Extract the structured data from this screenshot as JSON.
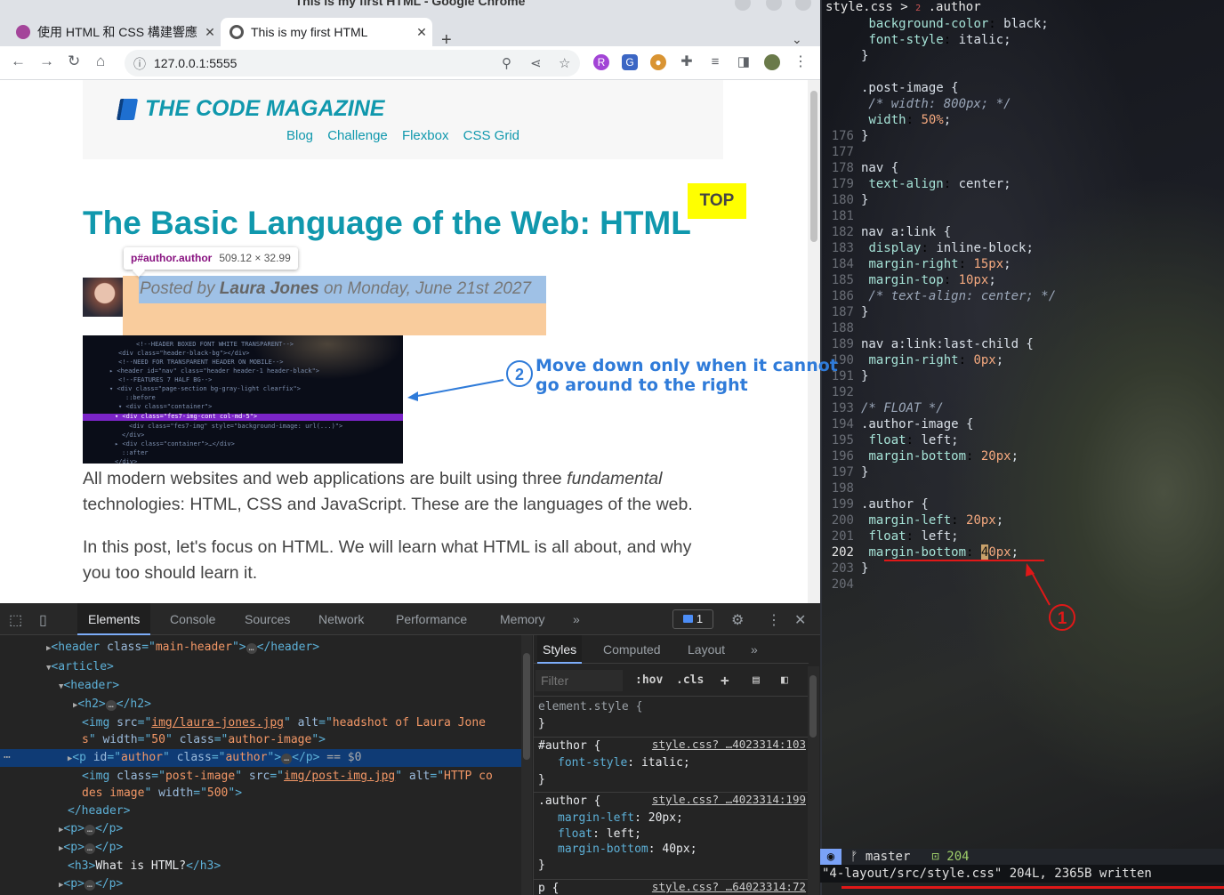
{
  "window": {
    "title": "This is my first HTML - Google Chrome"
  },
  "tabs": [
    {
      "label": "使用 HTML 和 CSS 構建響應",
      "close": "✕"
    },
    {
      "label": "This is my first HTML",
      "close": "✕"
    }
  ],
  "toolbar": {
    "url": "127.0.0.1:5555"
  },
  "page": {
    "logo": "THE CODE MAGAZINE",
    "nav": [
      "Blog",
      "Challenge",
      "Flexbox",
      "CSS Grid"
    ],
    "top_button": "TOP",
    "title": "The Basic Language of the Web: HTML",
    "tooltip": {
      "selector": "p#author.author",
      "size": "509.12 × 32.99"
    },
    "author": {
      "prefix": "Posted by ",
      "name": "Laura Jones",
      "suffix": " on Monday, June 21st 2027"
    },
    "para1_a": "All modern websites and web applications are built using three ",
    "para1_em": "fundamental",
    "para1_b": " technologies: HTML, CSS and JavaScript. These are the languages of the web.",
    "para2": "In this post, let's focus on HTML. We will learn what HTML is all about, and why you too should learn it."
  },
  "annotations": {
    "two": {
      "number": "2",
      "line1": "Move down only when it cannot",
      "line2": "go around to the right",
      "color": "#2f7bd9"
    },
    "one": {
      "number": "1",
      "color": "#e01818"
    }
  },
  "devtools": {
    "tabs": [
      "Elements",
      "Console",
      "Sources",
      "Network",
      "Performance",
      "Memory"
    ],
    "more": "»",
    "messages": "1",
    "dom": {
      "header_main": {
        "tag": "header",
        "attr": "class",
        "val": "main-header"
      },
      "article": "article",
      "header": "header",
      "h2": "h2",
      "img_src": "img/laura-jones.jpg",
      "img_alt_1": "headshot of Laura Jone",
      "img_alt_2": "s",
      "img_width": "50",
      "img_class": "author-image",
      "p_id": "author",
      "p_class": "author",
      "dollar0": "== $0",
      "img2_class": "post-image",
      "img2_src": "img/post-img.jpg",
      "img2_alt_1": "HTTP co",
      "img2_alt_2": "des image",
      "img2_width": "500",
      "h3_text": "What is HTML?"
    },
    "styles": {
      "tabs": [
        "Styles",
        "Computed",
        "Layout"
      ],
      "filter_placeholder": "Filter",
      "hov": ":hov",
      "cls": ".cls",
      "element_style": "element.style {",
      "rules": [
        {
          "selector": "#author {",
          "source": "style.css? …4023314:103",
          "decls": [
            {
              "prop": "font-style",
              "val": "italic;"
            }
          ]
        },
        {
          "selector": ".author {",
          "source": "style.css? …4023314:199",
          "decls": [
            {
              "prop": "margin-left",
              "val": "20px;"
            },
            {
              "prop": "float",
              "val": "left;"
            },
            {
              "prop": "margin-bottom",
              "val": "40px;"
            }
          ]
        },
        {
          "selector": "p {",
          "source": "style.css? …64023314:72",
          "decls": []
        }
      ]
    }
  },
  "editor": {
    "file": "style.css",
    "crumb": " > ",
    "crumb_num": "2",
    "crumb_sel": " .author",
    "lines": [
      {
        "n": "",
        "t": "  background-color: black;"
      },
      {
        "n": "",
        "t": "  font-style: italic;"
      },
      {
        "n": "",
        "t": "}"
      },
      {
        "n": "",
        "t": ""
      },
      {
        "n": "",
        "t": ".post-image {"
      },
      {
        "n": "",
        "t": "  /* width: 800px;  */"
      },
      {
        "n": "",
        "t": "  width: 50%;"
      },
      {
        "n": "176",
        "t": "}"
      },
      {
        "n": "177",
        "t": ""
      },
      {
        "n": "178",
        "t": "nav {"
      },
      {
        "n": "179",
        "t": "  text-align: center;"
      },
      {
        "n": "180",
        "t": "}"
      },
      {
        "n": "181",
        "t": ""
      },
      {
        "n": "182",
        "t": "nav a:link {"
      },
      {
        "n": "183",
        "t": "  display: inline-block;"
      },
      {
        "n": "184",
        "t": "  margin-right: 15px;"
      },
      {
        "n": "185",
        "t": "  margin-top: 10px;"
      },
      {
        "n": "186",
        "t": "  /* text-align: center; */"
      },
      {
        "n": "187",
        "t": "}"
      },
      {
        "n": "188",
        "t": ""
      },
      {
        "n": "189",
        "t": "nav a:link:last-child {"
      },
      {
        "n": "190",
        "t": "  margin-right: 0px;"
      },
      {
        "n": "191",
        "t": "}"
      },
      {
        "n": "192",
        "t": ""
      },
      {
        "n": "193",
        "t": "/* FLOAT */"
      },
      {
        "n": "194",
        "t": ".author-image {"
      },
      {
        "n": "195",
        "t": "  float: left;"
      },
      {
        "n": "196",
        "t": "  margin-bottom: 20px;"
      },
      {
        "n": "197",
        "t": "}"
      },
      {
        "n": "198",
        "t": ""
      },
      {
        "n": "199",
        "t": ".author {"
      },
      {
        "n": "200",
        "t": "  margin-left: 20px;"
      },
      {
        "n": "201",
        "t": "  float: left;"
      },
      {
        "n": "202",
        "t": "  margin-bottom: 40px;"
      },
      {
        "n": "203",
        "t": "}"
      },
      {
        "n": "204",
        "t": ""
      }
    ],
    "status": {
      "mode": "◉",
      "branch": "ᚠ master",
      "count": "⊡ 204"
    },
    "cmdline": "\"4-layout/src/style.css\" 204L, 2365B written"
  }
}
